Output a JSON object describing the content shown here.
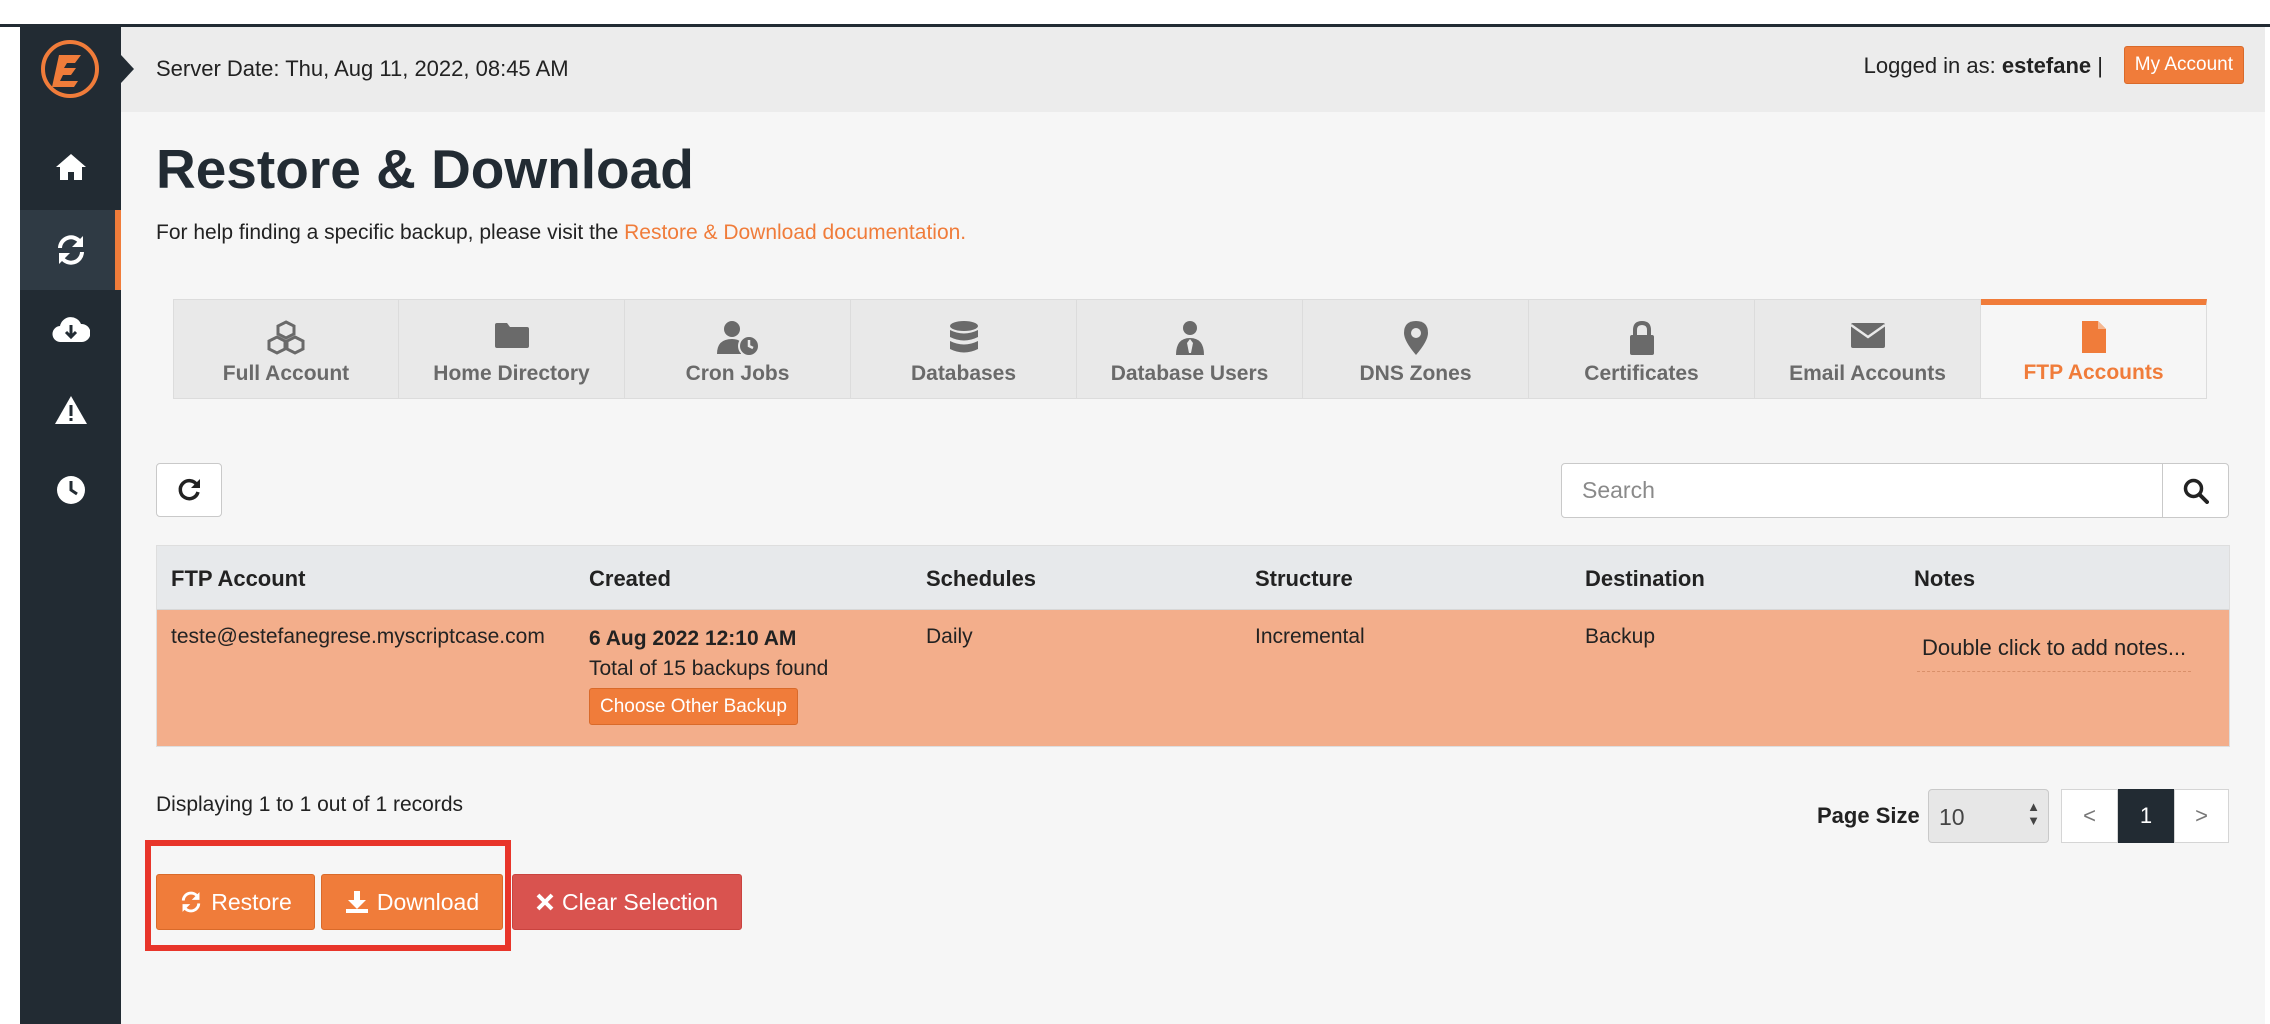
{
  "header": {
    "server_date": "Server Date: Thu, Aug 11, 2022, 08:45 AM",
    "logged_in_prefix": "Logged in as:",
    "username": "estefane",
    "separator": "|",
    "my_account_label": "My Account"
  },
  "sidebar": {
    "items": [
      {
        "icon": "home-icon",
        "active": false
      },
      {
        "icon": "refresh-icon",
        "active": true
      },
      {
        "icon": "cloud-download-icon",
        "active": false
      },
      {
        "icon": "warning-icon",
        "active": false
      },
      {
        "icon": "clock-icon",
        "active": false
      }
    ]
  },
  "page": {
    "title": "Restore & Download",
    "help_text": "For help finding a specific backup, please visit the",
    "help_link": "Restore & Download documentation."
  },
  "tabs": [
    {
      "label": "Full Account",
      "icon": "cubes-icon",
      "active": false
    },
    {
      "label": "Home Directory",
      "icon": "folder-icon",
      "active": false
    },
    {
      "label": "Cron Jobs",
      "icon": "user-clock-icon",
      "active": false
    },
    {
      "label": "Databases",
      "icon": "database-icon",
      "active": false
    },
    {
      "label": "Database Users",
      "icon": "user-tie-icon",
      "active": false
    },
    {
      "label": "DNS Zones",
      "icon": "map-marker-icon",
      "active": false
    },
    {
      "label": "Certificates",
      "icon": "lock-icon",
      "active": false
    },
    {
      "label": "Email Accounts",
      "icon": "envelope-icon",
      "active": false
    },
    {
      "label": "FTP Accounts",
      "icon": "file-icon",
      "active": true
    }
  ],
  "search": {
    "placeholder": "Search"
  },
  "table": {
    "columns": [
      "FTP Account",
      "Created",
      "Schedules",
      "Structure",
      "Destination",
      "Notes"
    ],
    "rows": [
      {
        "ftp_account": "teste@estefanegrese.myscriptcase.com",
        "created_date": "6 Aug 2022 12:10 AM",
        "backups_found": "Total of 15 backups found",
        "choose_other_label": "Choose Other Backup",
        "schedules": "Daily",
        "structure": "Incremental",
        "destination": "Backup",
        "notes": "Double click to add notes..."
      }
    ]
  },
  "footer": {
    "displaying": "Displaying 1 to 1 out of 1 records",
    "page_size_label": "Page Size",
    "page_size_value": "10",
    "prev_label": "<",
    "current_page": "1",
    "next_label": ">"
  },
  "actions": {
    "restore_label": "Restore",
    "download_label": "Download",
    "clear_label": "Clear Selection"
  },
  "colors": {
    "accent": "#f07c3a",
    "sidebar": "#222b33",
    "selected_row": "#f3ae8b",
    "danger": "#d9534f",
    "highlight": "#e8352a"
  }
}
